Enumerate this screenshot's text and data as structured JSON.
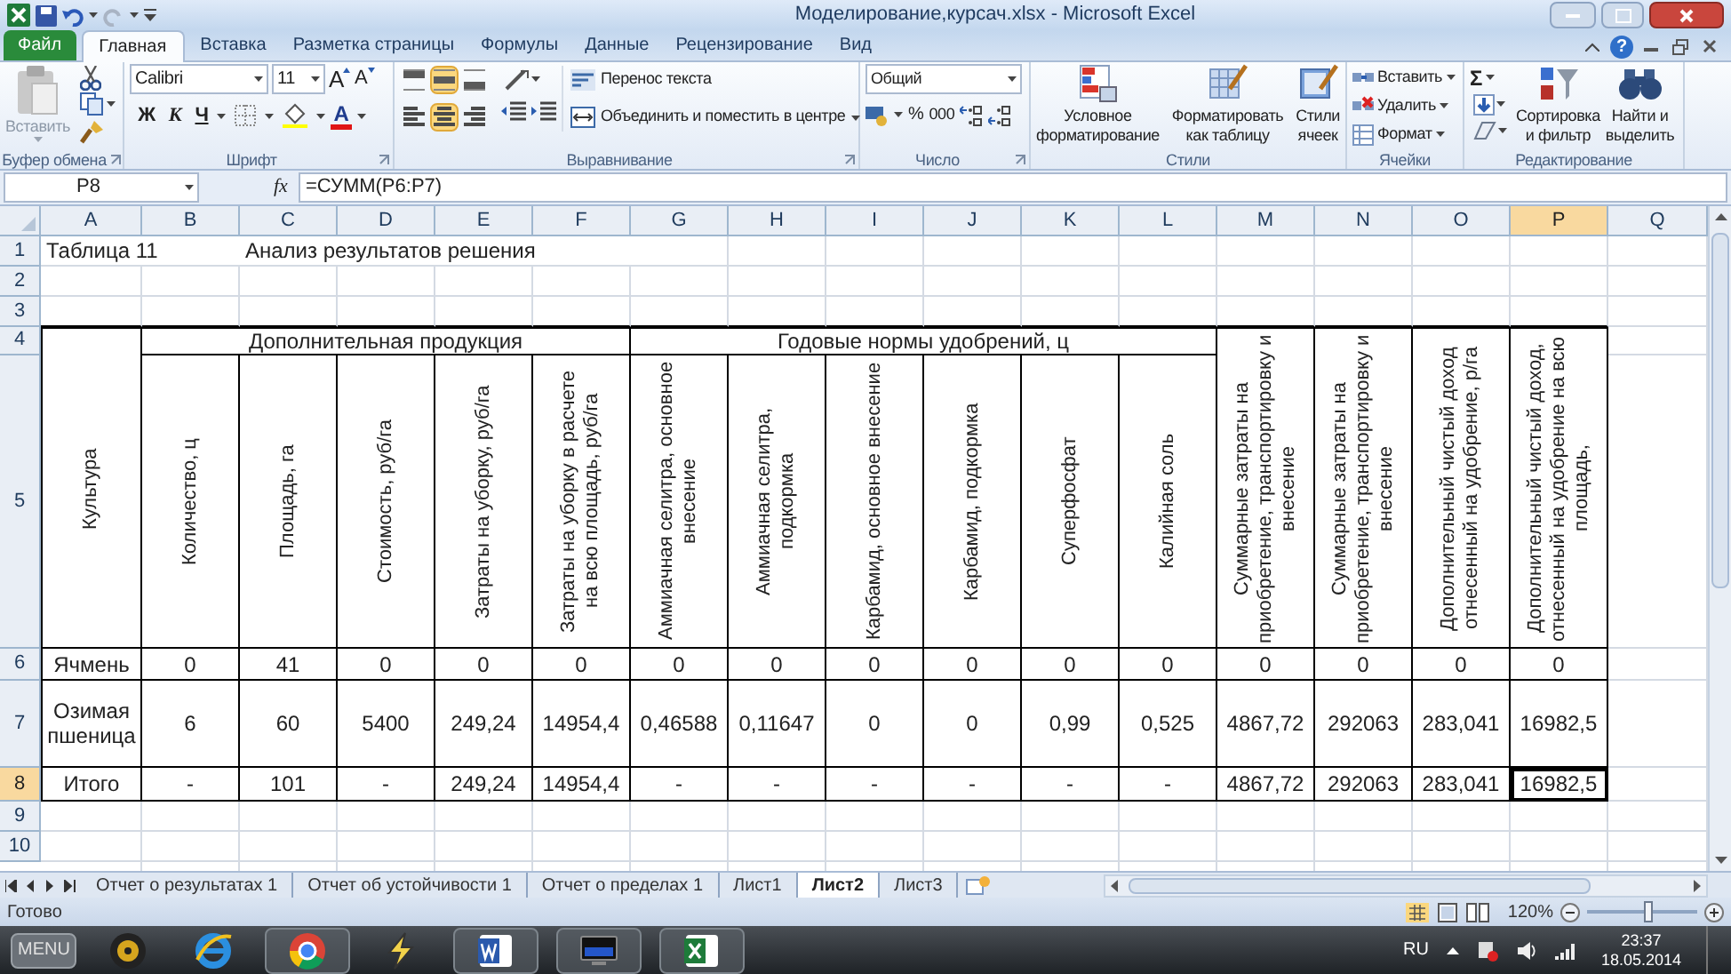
{
  "window": {
    "title": "Моделирование,курсач.xlsx - Microsoft Excel",
    "help": "?"
  },
  "tabs": [
    {
      "label": "Файл",
      "kind": "file",
      "selected": false
    },
    {
      "label": "Главная",
      "kind": "tab",
      "selected": true
    },
    {
      "label": "Вставка",
      "kind": "tab",
      "selected": false
    },
    {
      "label": "Разметка страницы",
      "kind": "tab",
      "selected": false
    },
    {
      "label": "Формулы",
      "kind": "tab",
      "selected": false
    },
    {
      "label": "Данные",
      "kind": "tab",
      "selected": false
    },
    {
      "label": "Рецензирование",
      "kind": "tab",
      "selected": false
    },
    {
      "label": "Вид",
      "kind": "tab",
      "selected": false
    }
  ],
  "ribbon": {
    "clipboard": {
      "label": "Буфер обмена",
      "paste": "Вставить",
      "paste_disabled": true
    },
    "font": {
      "label": "Шрифт",
      "name": "Calibri",
      "size": "11",
      "grow": "A",
      "shrink": "A",
      "bold": "Ж",
      "italic": "К",
      "underline": "Ч",
      "color_letter": "A"
    },
    "alignment": {
      "label": "Выравнивание",
      "wrap": "Перенос текста",
      "merge": "Объединить и поместить в центре",
      "align_buttons": [
        {
          "selected": false
        },
        {
          "selected": true
        },
        {
          "selected": false
        },
        {
          "selected": false
        },
        {
          "selected": true
        },
        {
          "selected": false
        }
      ]
    },
    "number": {
      "label": "Число",
      "format": "Общий",
      "percent": "%",
      "thousands": "000"
    },
    "styles": {
      "label": "Стили",
      "buttons": [
        [
          "Условное",
          "форматирование"
        ],
        [
          "Форматировать",
          "как таблицу"
        ],
        [
          "Стили",
          "ячеек"
        ]
      ]
    },
    "cells": {
      "label": "Ячейки",
      "buttons": [
        "Вставить",
        "Удалить",
        "Формат"
      ]
    },
    "editing": {
      "label": "Редактирование",
      "sum": "Σ",
      "buttons": [
        [
          "Сортировка",
          "и фильтр"
        ],
        [
          "Найти и",
          "выделить"
        ]
      ]
    }
  },
  "formula_bar": {
    "name_box": "P8",
    "fx": "fx",
    "formula": "=СУММ(P6:P7)"
  },
  "sheet": {
    "columns": [
      {
        "label": "A",
        "selected": false
      },
      {
        "label": "B",
        "selected": false
      },
      {
        "label": "C",
        "selected": false
      },
      {
        "label": "D",
        "selected": false
      },
      {
        "label": "E",
        "selected": false
      },
      {
        "label": "F",
        "selected": false
      },
      {
        "label": "G",
        "selected": false
      },
      {
        "label": "H",
        "selected": false
      },
      {
        "label": "I",
        "selected": false
      },
      {
        "label": "J",
        "selected": false
      },
      {
        "label": "K",
        "selected": false
      },
      {
        "label": "L",
        "selected": false
      },
      {
        "label": "M",
        "selected": false
      },
      {
        "label": "N",
        "selected": false
      },
      {
        "label": "O",
        "selected": false
      },
      {
        "label": "P",
        "selected": true
      },
      {
        "label": "Q",
        "selected": false
      }
    ],
    "rows": [
      {
        "label": "1",
        "selected": false
      },
      {
        "label": "2",
        "selected": false
      },
      {
        "label": "3",
        "selected": false
      },
      {
        "label": "4",
        "selected": false
      },
      {
        "label": "5",
        "selected": false
      },
      {
        "label": "6",
        "selected": false
      },
      {
        "label": "7",
        "selected": false
      },
      {
        "label": "8",
        "selected": true
      },
      {
        "label": "9",
        "selected": false
      },
      {
        "label": "10",
        "selected": false
      }
    ],
    "title": "Таблица 11",
    "caption": "Анализ результатов решения",
    "table": {
      "crop_header": "Культура",
      "groups": [
        "Дополнительная продукция",
        "Годовые нормы удобрений, ц"
      ],
      "headers": [
        "Количество, ц",
        "Площадь, га",
        "Стоимость, руб/га",
        "Затраты на уборку, руб/га",
        "Затраты на уборку в расчете на всю площадь, руб/га",
        "Аммиачная селитра, основное внесение",
        "Аммиачная селитра, подкормка",
        "Карбамид, основное внесение",
        "Карбамид, подкормка",
        "Суперфосфат",
        "Калийная соль",
        "Суммарные затраты на приобретение, транспортировку и внесение",
        "Суммарные затраты на приобретение, транспортировку и внесение",
        "Дополнительный чистый доход отнесенный на удобрение,  р/га",
        "Дополнительный чистый доход, отнесенный на удобрение на всю площадь,"
      ],
      "rows": [
        [
          "Ячмень",
          "0",
          "41",
          "0",
          "0",
          "0",
          "0",
          "0",
          "0",
          "0",
          "0",
          "0",
          "0",
          "0",
          "0",
          "0"
        ],
        [
          "Озимая пшеница",
          "6",
          "60",
          "5400",
          "249,24",
          "14954,4",
          "0,46588",
          "0,11647",
          "0",
          "0",
          "0,99",
          "0,525",
          "4867,72",
          "292063",
          "283,041",
          "16982,5"
        ],
        [
          "Итого",
          "-",
          "101",
          "-",
          "249,24",
          "14954,4",
          "-",
          "-",
          "-",
          "-",
          "-",
          "-",
          "4867,72",
          "292063",
          "283,041",
          "16982,5"
        ]
      ]
    }
  },
  "sheet_tabs": [
    {
      "label": "Отчет о результатах 1",
      "selected": false
    },
    {
      "label": "Отчет об устойчивости 1",
      "selected": false
    },
    {
      "label": "Отчет о пределах 1",
      "selected": false
    },
    {
      "label": "Лист1",
      "selected": false
    },
    {
      "label": "Лист2",
      "selected": true
    },
    {
      "label": "Лист3",
      "selected": false
    }
  ],
  "status_bar": {
    "text": "Готово",
    "zoom": "120%",
    "level": 0.55
  },
  "taskbar": {
    "start": "MENU",
    "language": "RU",
    "time": "23:37",
    "date": "18.05.2014"
  }
}
